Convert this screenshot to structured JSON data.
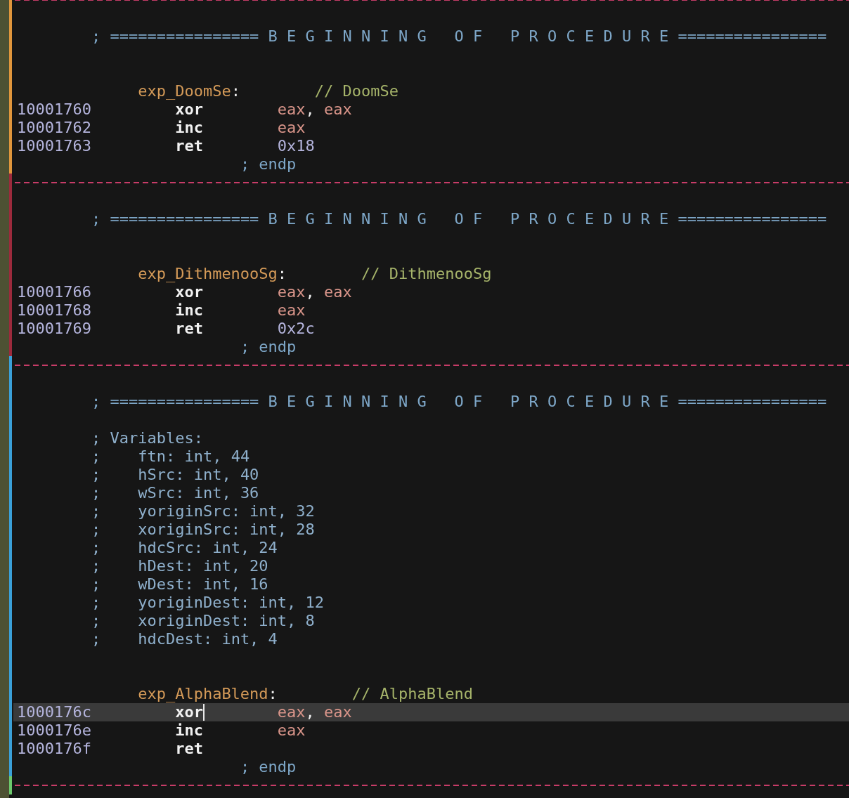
{
  "blocks": [
    {
      "color": "#e0963c",
      "lines": [
        {
          "kind": "blank"
        },
        {
          "kind": "header",
          "text": "; ================ B E G I N N I N G   O F   P R O C E D U R E ================"
        },
        {
          "kind": "blank"
        },
        {
          "kind": "blank"
        },
        {
          "kind": "label",
          "name": "exp_DoomSe",
          "colon": ":",
          "comment": "// DoomSe"
        },
        {
          "kind": "instruction",
          "address": "10001760",
          "mnemonic": "xor",
          "selected": false,
          "operands": [
            {
              "kind": "register",
              "text": "eax"
            },
            {
              "kind": "punct",
              "text": ", "
            },
            {
              "kind": "register",
              "text": "eax"
            }
          ]
        },
        {
          "kind": "instruction",
          "address": "10001762",
          "mnemonic": "inc",
          "selected": false,
          "operands": [
            {
              "kind": "register",
              "text": "eax"
            }
          ]
        },
        {
          "kind": "instruction",
          "address": "10001763",
          "mnemonic": "ret",
          "selected": false,
          "operands": [
            {
              "kind": "number",
              "text": "0x18"
            }
          ]
        },
        {
          "kind": "endp",
          "text": "; endp"
        }
      ]
    },
    {
      "color": "#9c2a3c",
      "lines": [
        {
          "kind": "blank"
        },
        {
          "kind": "header",
          "text": "; ================ B E G I N N I N G   O F   P R O C E D U R E ================"
        },
        {
          "kind": "blank"
        },
        {
          "kind": "blank"
        },
        {
          "kind": "label",
          "name": "exp_DithmenooSg",
          "colon": ":",
          "comment": "// DithmenooSg"
        },
        {
          "kind": "instruction",
          "address": "10001766",
          "mnemonic": "xor",
          "selected": false,
          "operands": [
            {
              "kind": "register",
              "text": "eax"
            },
            {
              "kind": "punct",
              "text": ", "
            },
            {
              "kind": "register",
              "text": "eax"
            }
          ]
        },
        {
          "kind": "instruction",
          "address": "10001768",
          "mnemonic": "inc",
          "selected": false,
          "operands": [
            {
              "kind": "register",
              "text": "eax"
            }
          ]
        },
        {
          "kind": "instruction",
          "address": "10001769",
          "mnemonic": "ret",
          "selected": false,
          "operands": [
            {
              "kind": "number",
              "text": "0x2c"
            }
          ]
        },
        {
          "kind": "endp",
          "text": "; endp"
        }
      ]
    },
    {
      "color": "#3aa0d8",
      "lines": [
        {
          "kind": "blank"
        },
        {
          "kind": "header",
          "text": "; ================ B E G I N N I N G   O F   P R O C E D U R E ================"
        },
        {
          "kind": "blank"
        },
        {
          "kind": "comment",
          "text": "; Variables:"
        },
        {
          "kind": "comment",
          "text": ";    ftn: int, 44"
        },
        {
          "kind": "comment",
          "text": ";    hSrc: int, 40"
        },
        {
          "kind": "comment",
          "text": ";    wSrc: int, 36"
        },
        {
          "kind": "comment",
          "text": ";    yoriginSrc: int, 32"
        },
        {
          "kind": "comment",
          "text": ";    xoriginSrc: int, 28"
        },
        {
          "kind": "comment",
          "text": ";    hdcSrc: int, 24"
        },
        {
          "kind": "comment",
          "text": ";    hDest: int, 20"
        },
        {
          "kind": "comment",
          "text": ";    wDest: int, 16"
        },
        {
          "kind": "comment",
          "text": ";    yoriginDest: int, 12"
        },
        {
          "kind": "comment",
          "text": ";    xoriginDest: int, 8"
        },
        {
          "kind": "comment",
          "text": ";    hdcDest: int, 4"
        },
        {
          "kind": "blank"
        },
        {
          "kind": "blank"
        },
        {
          "kind": "label",
          "name": "exp_AlphaBlend",
          "colon": ":",
          "comment": "// AlphaBlend"
        },
        {
          "kind": "instruction",
          "address": "1000176c",
          "mnemonic": "xor",
          "selected": true,
          "operands": [
            {
              "kind": "register",
              "text": "eax"
            },
            {
              "kind": "punct",
              "text": ", "
            },
            {
              "kind": "register",
              "text": "eax"
            }
          ]
        },
        {
          "kind": "instruction",
          "address": "1000176e",
          "mnemonic": "inc",
          "selected": false,
          "operands": [
            {
              "kind": "register",
              "text": "eax"
            }
          ]
        },
        {
          "kind": "instruction",
          "address": "1000176f",
          "mnemonic": "ret",
          "selected": false
        },
        {
          "kind": "endp",
          "text": "; endp"
        }
      ]
    },
    {
      "color": "#6cc86c"
    }
  ]
}
